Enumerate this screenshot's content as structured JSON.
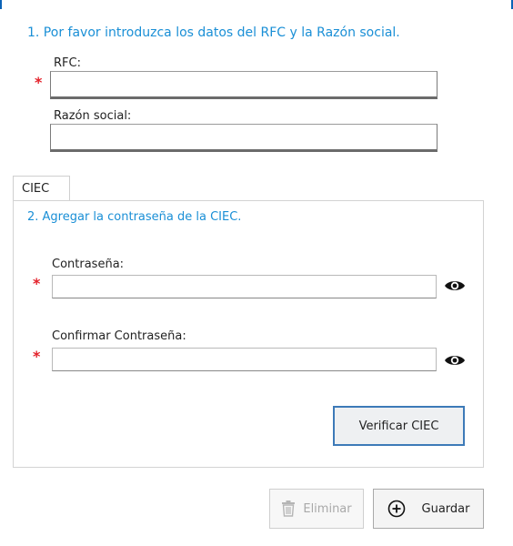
{
  "section1": {
    "title": "1. Por favor introduzca los datos del RFC y la Razón social.",
    "rfc_label": "RFC:",
    "rfc_value": "",
    "razon_label": "Razón social:",
    "razon_value": "",
    "required_mark": "*"
  },
  "tab": {
    "label": "CIEC"
  },
  "section2": {
    "title": "2. Agregar la contraseña de la CIEC.",
    "password_label": "Contraseña:",
    "password_value": "",
    "confirm_label": "Confirmar Contraseña:",
    "confirm_value": "",
    "required_mark": "*",
    "verify_label": "Verificar CIEC"
  },
  "actions": {
    "delete_label": "Eliminar",
    "save_label": "Guardar"
  },
  "icons": {
    "eye": "eye-icon",
    "trash": "trash-icon",
    "add": "add-circle-icon"
  },
  "colors": {
    "accent": "#1a8fd6",
    "required": "#e3212a",
    "verify_border": "#3d7ab8"
  }
}
